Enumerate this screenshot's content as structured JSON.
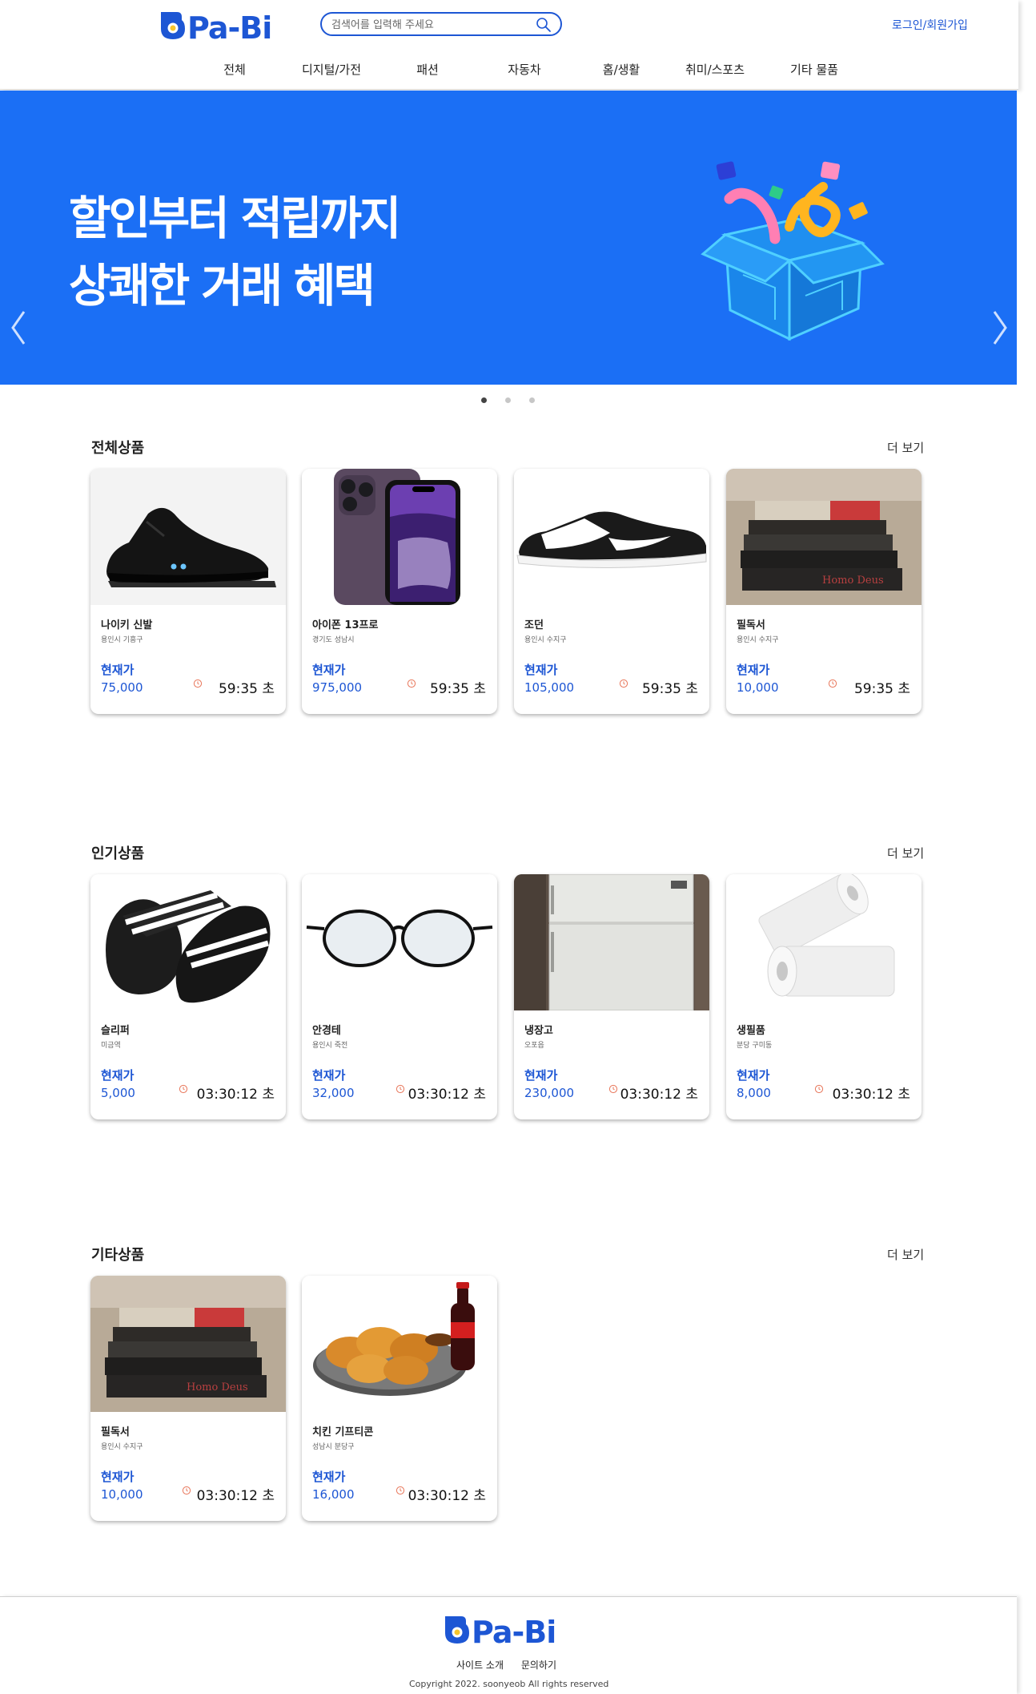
{
  "header": {
    "logo_text": "Pa-Bi",
    "search_placeholder": "검색어를 입력해 주세요",
    "login_label": "로그인/회원가입"
  },
  "nav": {
    "items": [
      {
        "label": "전체"
      },
      {
        "label": "디지털/가전"
      },
      {
        "label": "패션"
      },
      {
        "label": "자동차"
      },
      {
        "label": "홈/생활"
      },
      {
        "label": "취미/스포츠"
      },
      {
        "label": "기타 물품"
      }
    ]
  },
  "banner": {
    "line1": "할인부터 적립까지",
    "line2": "상쾌한 거래 혜택",
    "background": "#1b6ff5",
    "slide_count": 3,
    "active_slide": 1
  },
  "colors": {
    "accent": "#1d56d4",
    "clock": "#e8765a"
  },
  "sections": [
    {
      "title": "전체상품",
      "more_label": "더 보기",
      "products": [
        {
          "name": "나이키 신발",
          "location": "용인시 기흥구",
          "price_label": "현재가",
          "price": "75,000",
          "timer": "59:35 초",
          "image": "sneaker-black"
        },
        {
          "name": "아이폰 13프로",
          "location": "경기도 성남시",
          "price_label": "현재가",
          "price": "975,000",
          "timer": "59:35 초",
          "image": "iphone"
        },
        {
          "name": "조던",
          "location": "용인시 수지구",
          "price_label": "현재가",
          "price": "105,000",
          "timer": "59:35 초",
          "image": "sneaker-panda"
        },
        {
          "name": "필독서",
          "location": "용인시 수지구",
          "price_label": "현재가",
          "price": "10,000",
          "timer": "59:35 초",
          "image": "books"
        }
      ]
    },
    {
      "title": "인기상품",
      "more_label": "더 보기",
      "products": [
        {
          "name": "슬리퍼",
          "location": "미금역",
          "price_label": "현재가",
          "price": "5,000",
          "timer": "03:30:12 초",
          "image": "slippers"
        },
        {
          "name": "안경테",
          "location": "용인시 죽전",
          "price_label": "현재가",
          "price": "32,000",
          "timer": "03:30:12 초",
          "image": "glasses"
        },
        {
          "name": "냉장고",
          "location": "오포읍",
          "price_label": "현재가",
          "price": "230,000",
          "timer": "03:30:12 초",
          "image": "fridge"
        },
        {
          "name": "생필품",
          "location": "분당 구미동",
          "price_label": "현재가",
          "price": "8,000",
          "timer": "03:30:12 초",
          "image": "paper-towels"
        }
      ]
    },
    {
      "title": "기타상품",
      "more_label": "더 보기",
      "products": [
        {
          "name": "필독서",
          "location": "용인시 수지구",
          "price_label": "현재가",
          "price": "10,000",
          "timer": "03:30:12 초",
          "image": "books"
        },
        {
          "name": "치킨 기프티콘",
          "location": "성남시 분당구",
          "price_label": "현재가",
          "price": "16,000",
          "timer": "03:30:12 초",
          "image": "chicken"
        }
      ]
    }
  ],
  "footer": {
    "logo_text": "Pa-Bi",
    "links": [
      "사이트 소개",
      "문의하기"
    ],
    "copyright": "Copyright 2022. soonyeob All rights reserved"
  }
}
